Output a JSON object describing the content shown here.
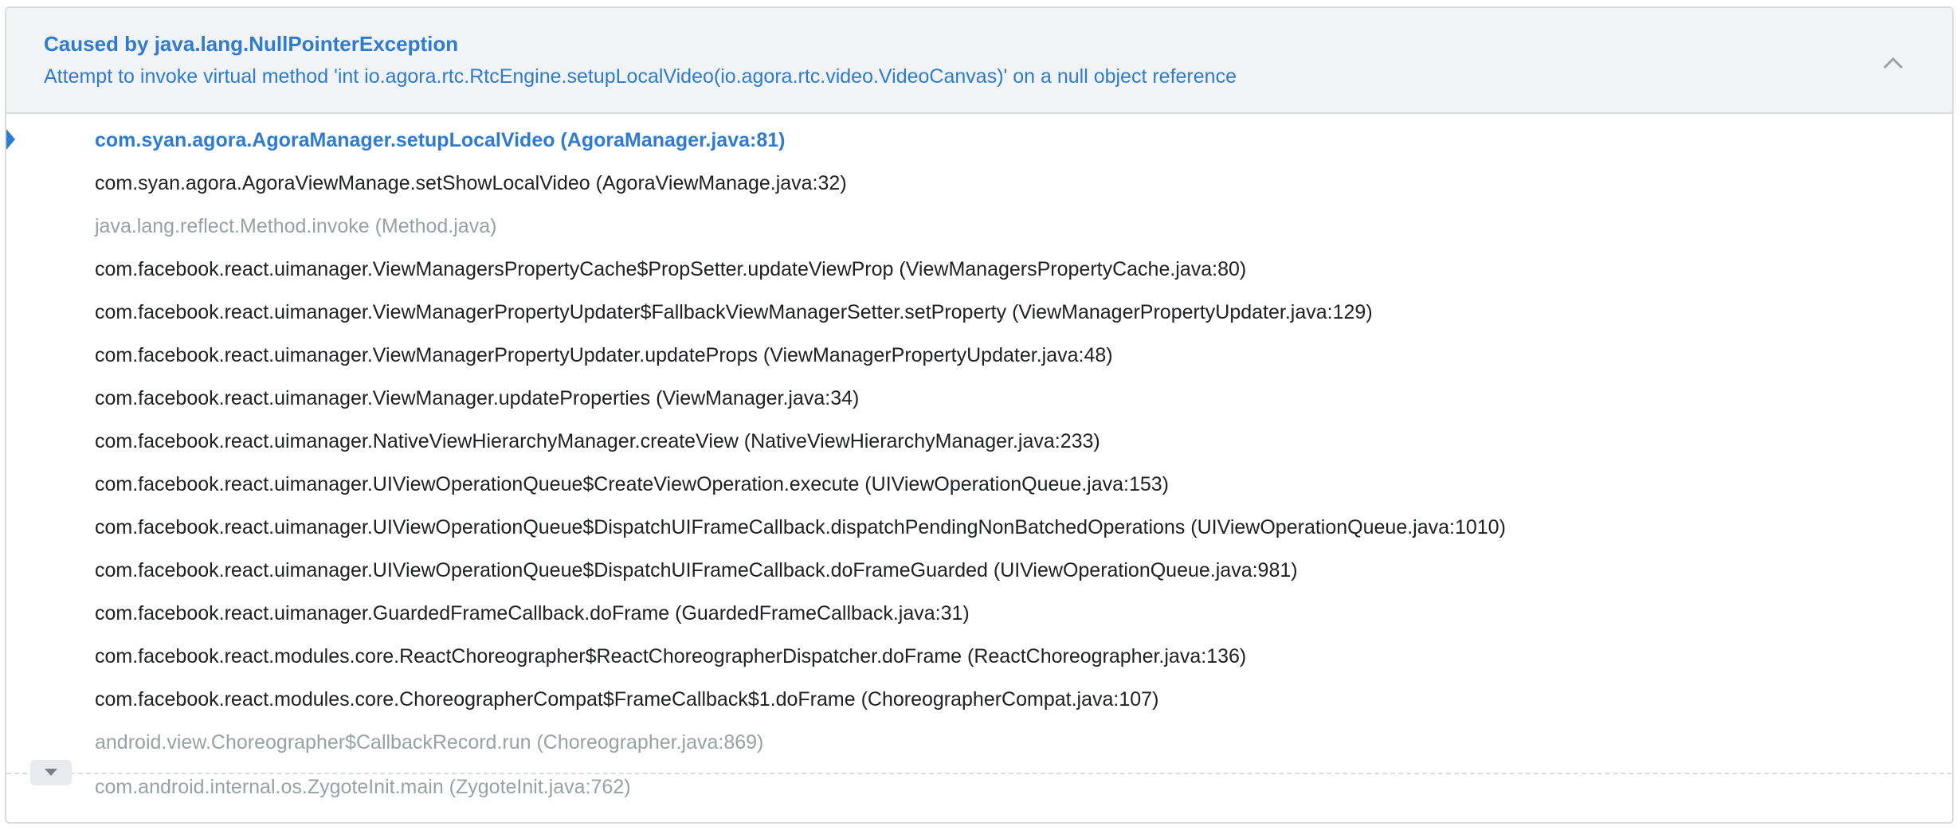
{
  "exception": {
    "title": "Caused by java.lang.NullPointerException",
    "message": "Attempt to invoke virtual method 'int io.agora.rtc.RtcEngine.setupLocalVideo(io.agora.rtc.video.VideoCanvas)' on a null object reference"
  },
  "icons": {
    "collapse": "chevron-up-icon",
    "expand": "chevron-down-icon",
    "frame_marker": "triangle-right-icon"
  },
  "colors": {
    "accent": "#2f7bd0",
    "header_bg": "#f1f3f4",
    "text": "#202124",
    "dim_text": "#9aa0a6"
  },
  "frames": [
    {
      "text": "com.syan.agora.AgoraManager.setupLocalVideo (AgoraManager.java:81)",
      "style": "highlight"
    },
    {
      "text": "com.syan.agora.AgoraViewManage.setShowLocalVideo (AgoraViewManage.java:32)",
      "style": "normal"
    },
    {
      "text": "java.lang.reflect.Method.invoke (Method.java)",
      "style": "dim"
    },
    {
      "text": "com.facebook.react.uimanager.ViewManagersPropertyCache$PropSetter.updateViewProp (ViewManagersPropertyCache.java:80)",
      "style": "normal"
    },
    {
      "text": "com.facebook.react.uimanager.ViewManagerPropertyUpdater$FallbackViewManagerSetter.setProperty (ViewManagerPropertyUpdater.java:129)",
      "style": "normal"
    },
    {
      "text": "com.facebook.react.uimanager.ViewManagerPropertyUpdater.updateProps (ViewManagerPropertyUpdater.java:48)",
      "style": "normal"
    },
    {
      "text": "com.facebook.react.uimanager.ViewManager.updateProperties (ViewManager.java:34)",
      "style": "normal"
    },
    {
      "text": "com.facebook.react.uimanager.NativeViewHierarchyManager.createView (NativeViewHierarchyManager.java:233)",
      "style": "normal"
    },
    {
      "text": "com.facebook.react.uimanager.UIViewOperationQueue$CreateViewOperation.execute (UIViewOperationQueue.java:153)",
      "style": "normal"
    },
    {
      "text": "com.facebook.react.uimanager.UIViewOperationQueue$DispatchUIFrameCallback.dispatchPendingNonBatchedOperations (UIViewOperationQueue.java:1010)",
      "style": "normal"
    },
    {
      "text": "com.facebook.react.uimanager.UIViewOperationQueue$DispatchUIFrameCallback.doFrameGuarded (UIViewOperationQueue.java:981)",
      "style": "normal"
    },
    {
      "text": "com.facebook.react.uimanager.GuardedFrameCallback.doFrame (GuardedFrameCallback.java:31)",
      "style": "normal"
    },
    {
      "text": "com.facebook.react.modules.core.ReactChoreographer$ReactChoreographerDispatcher.doFrame (ReactChoreographer.java:136)",
      "style": "normal"
    },
    {
      "text": "com.facebook.react.modules.core.ChoreographerCompat$FrameCallback$1.doFrame (ChoreographerCompat.java:107)",
      "style": "normal"
    },
    {
      "text": "android.view.Choreographer$CallbackRecord.run (Choreographer.java:869)",
      "style": "dim"
    },
    {
      "text": "com.android.internal.os.ZygoteInit.main (ZygoteInit.java:762)",
      "style": "dim"
    }
  ]
}
